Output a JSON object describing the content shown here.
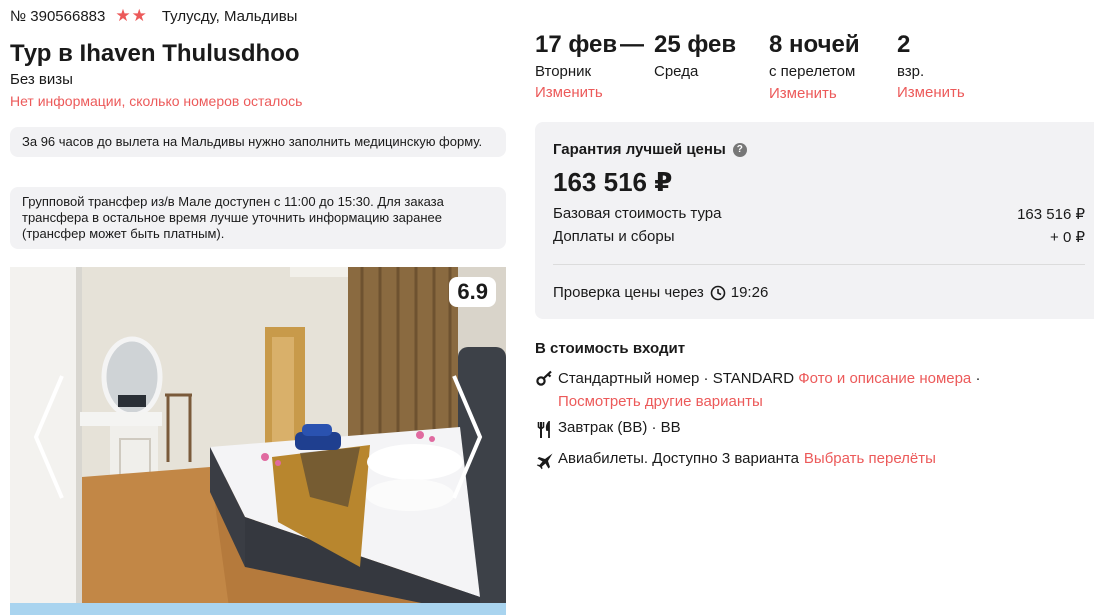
{
  "header": {
    "tour_number": "№ 390566883",
    "stars": "★★",
    "location": "Тулусду, Мальдивы",
    "title": "Тур в Ihaven Thulusdhoo",
    "visa": "Без визы",
    "rooms_info": "Нет информации, сколько номеров осталось"
  },
  "notes": [
    "За 96 часов до вылета на Мальдивы нужно заполнить медицинскую форму.",
    "Групповой трансфер из/в Мале доступен с 11:00 до 15:30. Для заказа трансфера в остальное время лучше уточнить информацию заранее (трансфер может быть платным)."
  ],
  "photo": {
    "rating": "6.9"
  },
  "trip": {
    "date_from": "17 фев",
    "dash": "—",
    "date_to": "25 фев",
    "day_from": "Вторник",
    "day_to": "Среда",
    "nights": "8 ночей",
    "nights_sub": "с перелетом",
    "adults": "2",
    "adults_sub": "взр.",
    "change_label": "Изменить"
  },
  "price": {
    "guarantee": "Гарантия лучшей цены",
    "total": "163 516 ₽",
    "base_label": "Базовая стоимость тура",
    "base_value": "163 516 ₽",
    "fees_label": "Доплаты и сборы",
    "fees_value": "+ 0 ₽",
    "check_label": "Проверка цены через",
    "check_time": "19:26"
  },
  "included": {
    "title": "В стоимость входит",
    "room": "Стандартный номер · STANDARD",
    "room_link": "Фото и описание номера",
    "room_sep": "·",
    "room_other": "Посмотреть другие варианты",
    "meal": "Завтрак (BB) · BB",
    "flights": "Авиабилеты. Доступно 3 варианта",
    "flights_link": "Выбрать перелёты"
  },
  "colors": {
    "accent": "#ec5a5a",
    "panel": "#f2f2f4"
  }
}
